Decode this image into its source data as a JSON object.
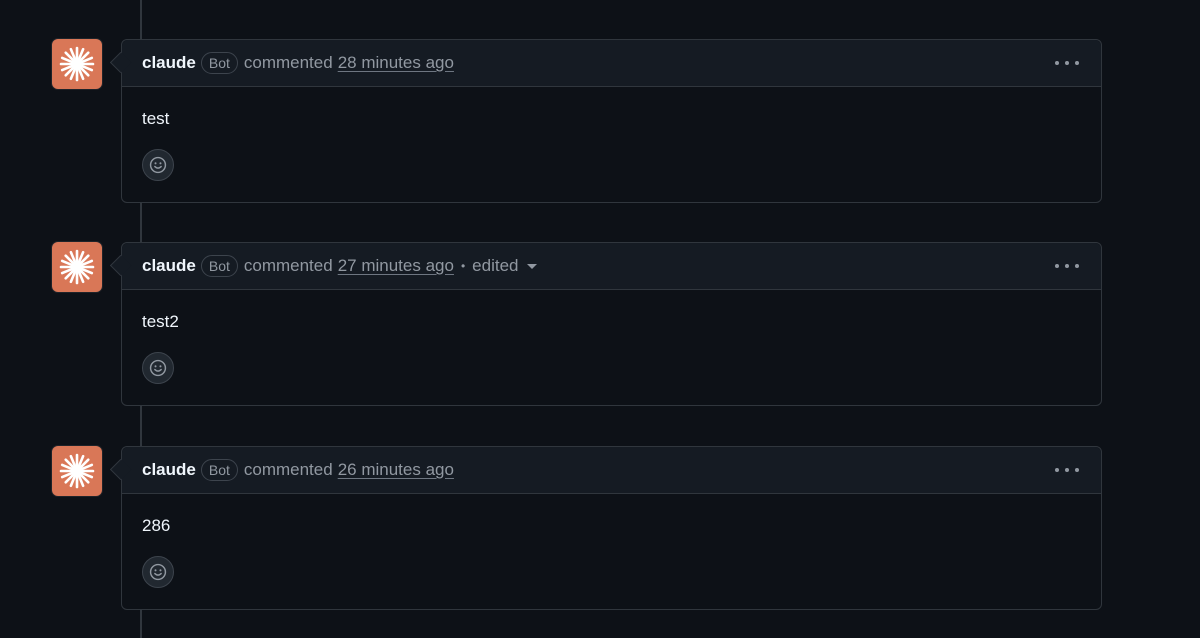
{
  "comments": [
    {
      "author": "claude",
      "badge": "Bot",
      "action": "commented",
      "time": "28 minutes ago",
      "edited": "",
      "body": "test"
    },
    {
      "author": "claude",
      "badge": "Bot",
      "action": "commented",
      "time": "27 minutes ago",
      "edited": "edited",
      "body": "test2"
    },
    {
      "author": "claude",
      "badge": "Bot",
      "action": "commented",
      "time": "26 minutes ago",
      "edited": "",
      "body": "286"
    }
  ],
  "icons": {
    "avatar": "claude-sparkle-icon",
    "menu": "kebab-horizontal-icon",
    "reaction": "smiley-icon"
  },
  "colors": {
    "background": "#0d1117",
    "header_background": "#151b23",
    "border": "#30363d",
    "avatar": "#d97757",
    "muted_text": "#9198a1"
  }
}
